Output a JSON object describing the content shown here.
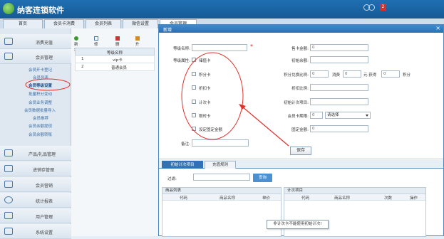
{
  "app": {
    "title": "纳客连锁软件",
    "notification_count": "2"
  },
  "navtabs": [
    "首页",
    "会员卡消费",
    "会员列表",
    "微信设置",
    "会员管理"
  ],
  "sidebar": {
    "groups": [
      {
        "label": "消费充值"
      },
      {
        "label": "会员管理"
      },
      {
        "label": "产品/礼品管理"
      },
      {
        "label": "进销存管理"
      },
      {
        "label": "会员营销"
      },
      {
        "label": "统计报表"
      },
      {
        "label": "用户管理"
      },
      {
        "label": "系统设置"
      }
    ],
    "sub_items": [
      "会员开卡登记",
      "会员列表",
      "会员等级设置",
      "批量积分变动",
      "会员业务调整",
      "会员数据批量导入",
      "会员推荐",
      "会员余额提现",
      "会员余额转账"
    ]
  },
  "toolbar": {
    "add": "新增",
    "edit": "修改",
    "delete": "删除",
    "upgrade": "升级"
  },
  "list": {
    "header": "等级名称",
    "rows": [
      {
        "no": "1",
        "name": "vip卡"
      },
      {
        "no": "2",
        "name": "普通会员"
      }
    ]
  },
  "modal": {
    "title": "新增",
    "close": "×",
    "fields": {
      "level_name_label": "等级名称:",
      "level_attr_label": "等级属性:",
      "note_label": "备注:",
      "card_amount_label": "售卡金额:",
      "card_amount_value": "0",
      "init_balance_label": "初始余额:",
      "points_ratio_label": "积分兑换比例:",
      "points_ratio_value": "0",
      "consume_label": "消费",
      "consume_value": "0",
      "yuan_label": "元 获得",
      "get_value": "0",
      "points_unit": "积分",
      "discount_label": "折扣比例:",
      "init_count_label": "初始计次项目:",
      "expire_label": "会员卡期限:",
      "expire_value": "0",
      "expire_select": "请选择",
      "fixed_amount_label": "固定金额:",
      "fixed_amount_value": "0"
    },
    "checkboxes": [
      "储值卡",
      "积分卡",
      "折扣卡",
      "计次卡",
      "限时卡",
      "设定固定金额"
    ],
    "save": "保存",
    "subtabs": [
      "初始计次项目",
      "充值规则"
    ],
    "filter_label": "过滤:",
    "query_button": "查询",
    "left_panel": {
      "title": "商品列表",
      "cols": [
        "代码",
        "商品名称",
        "单价"
      ]
    },
    "right_panel": {
      "title": "计次项目",
      "cols": [
        "代码",
        "商品名称",
        "次数",
        "操作"
      ]
    },
    "toast": "非计次卡不能使用初始计次!"
  }
}
